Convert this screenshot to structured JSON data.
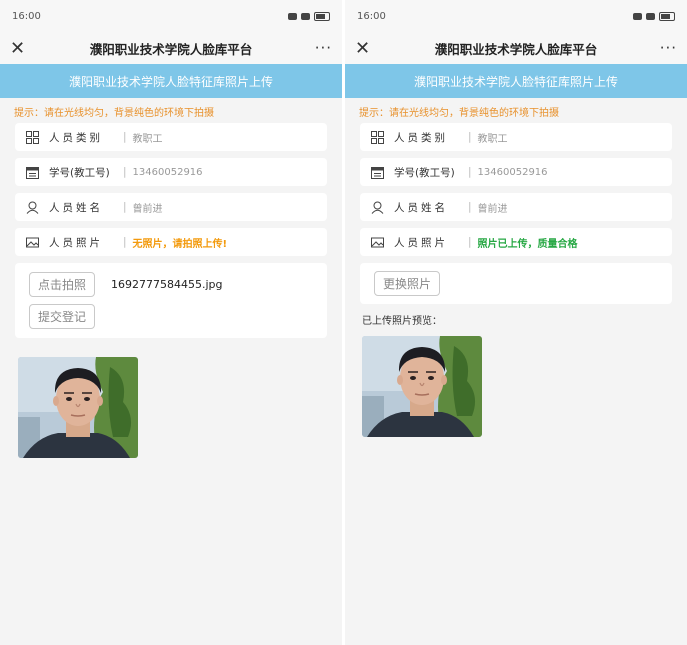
{
  "statusbar": {
    "time": "16:00"
  },
  "navbar": {
    "title": "濮阳职业技术学院人脸库平台",
    "close": "✕",
    "more": "···"
  },
  "banner": "濮阳职业技术学院人脸特征库照片上传",
  "hint": "提示：请在光线均匀，背景纯色的环境下拍摄",
  "form": {
    "category_label": "人员类别",
    "category_value": "教职工",
    "id_label": "学号(教工号)",
    "id_value": "13460052916",
    "name_label": "人员姓名",
    "name_value": "曾前进",
    "photo_label": "人员照片"
  },
  "left": {
    "photo_status": "无照片，请拍照上传!",
    "capture_button": "点击拍照",
    "file_name": "1692777584455.jpg",
    "submit_button": "提交登记"
  },
  "right": {
    "photo_status": "照片已上传，质量合格",
    "change_button": "更换照片",
    "preview_label": "已上传照片预览："
  },
  "colors": {
    "banner": "#7ec6e8",
    "hint": "#e8912b",
    "warn": "#f39a0d",
    "ok": "#27a844"
  }
}
